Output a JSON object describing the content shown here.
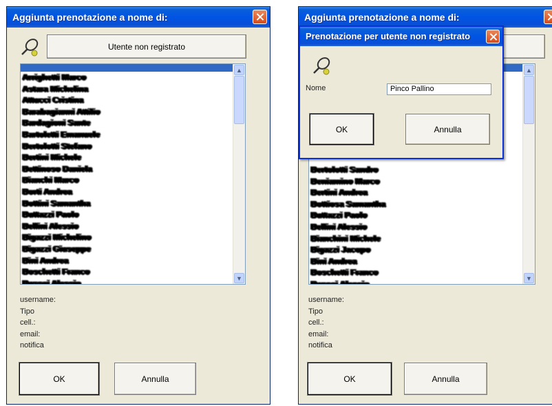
{
  "left_dialog": {
    "title": "Aggiunta prenotazione a nome di:",
    "unregistered_button": "Utente non registrato",
    "list_items": [
      "Arrighetti Marco",
      "Astara Michelina",
      "Attucci Cristina",
      "Barabagianni Attilio",
      "Bardagioni Sante",
      "Bartoletti Emanuele",
      "Bertolotti Stefano",
      "Bertini Michele",
      "Bettinoso Daniela",
      "Bianchi Marco",
      "Borti Andrea",
      "Bottini Samantha",
      "Buttazzi Paolo",
      "Bellini Alessio",
      "Bigazzi Michelino",
      "Bigazzi Giuseppe",
      "Bini Andrea",
      "Boschetti Franco",
      "Bussei Alessio"
    ],
    "info_labels": [
      "username:",
      "Tipo",
      "cell.:",
      "email:",
      "notifica"
    ],
    "ok": "OK",
    "cancel": "Annulla"
  },
  "right_dialog": {
    "title": "Aggiunta prenotazione a nome di:",
    "list_items": [
      "Bertolotti Sandro",
      "Beniamino Marco",
      "Bertini Andrea",
      "Bottiosa Samantha",
      "Buttazzi Paolo",
      "Bellini Alessio",
      "Bianchini Michele",
      "Bigazzi Jacopo",
      "Bini Andrea",
      "Boschetti Franco",
      "Bussei Alessio"
    ],
    "info_labels": [
      "username:",
      "Tipo",
      "cell.:",
      "email:",
      "notifica"
    ],
    "ok": "OK",
    "cancel": "Annulla"
  },
  "popup": {
    "title": "Prenotazione per utente non registrato",
    "name_label": "Nome",
    "name_value": "Pinco Pallino",
    "ok": "OK",
    "cancel": "Annulla"
  },
  "colors": {
    "titlebar": "#0054e3",
    "dialog_bg": "#ece9d8",
    "selection": "#316ac5"
  }
}
